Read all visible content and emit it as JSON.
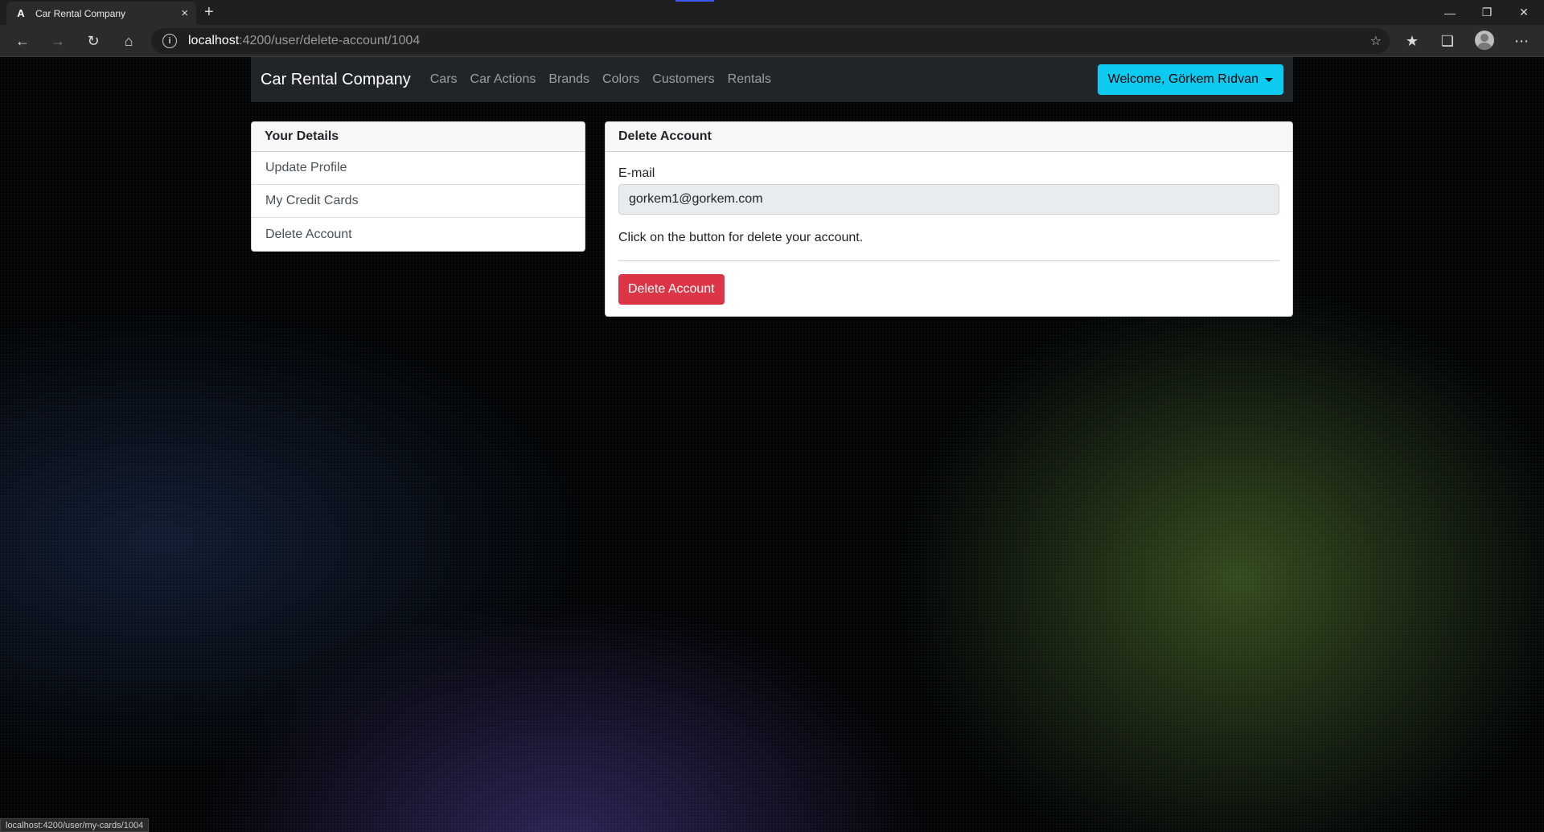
{
  "browser": {
    "tab_title": "Car Rental Company",
    "tab_favicon": "A",
    "new_tab": "+",
    "close_tab": "×",
    "url_host": "localhost",
    "url_path": ":4200/user/delete-account/1004",
    "status_url": "localhost:4200/user/my-cards/1004"
  },
  "navbar": {
    "brand": "Car Rental Company",
    "links": [
      "Cars",
      "Car Actions",
      "Brands",
      "Colors",
      "Customers",
      "Rentals"
    ],
    "welcome": "Welcome, Görkem Rıdvan",
    "welcome_color": "#0dcaf0"
  },
  "sidebar": {
    "title": "Your Details",
    "items": [
      "Update Profile",
      "My Credit Cards",
      "Delete Account"
    ]
  },
  "delete_card": {
    "title": "Delete Account",
    "email_label": "E-mail",
    "email_value": "gorkem1@gorkem.com",
    "hint": "Click on the button for delete your account.",
    "button": "Delete Account",
    "button_color": "#dc3545"
  }
}
